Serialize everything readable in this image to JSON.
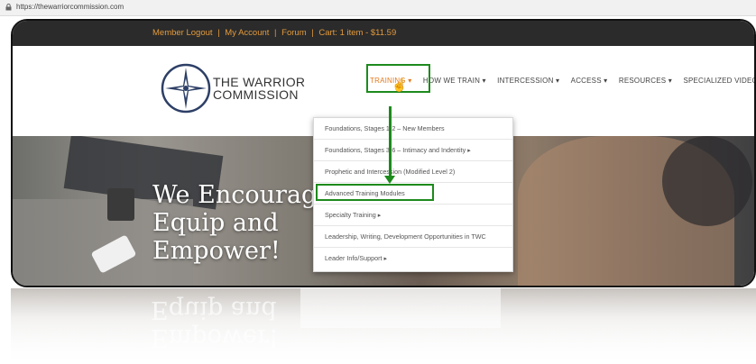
{
  "browser": {
    "url": "https://thewarriorcommission.com",
    "lock_icon": "lock-icon"
  },
  "topbar": {
    "member_logout": "Member Logout",
    "sep1": "|",
    "my_account": "My Account",
    "sep2": "|",
    "forum": "Forum",
    "sep3": "|",
    "cart": "Cart: 1 item - $11.59"
  },
  "brand": {
    "line1": "THE WARRIOR",
    "line2": "COMMISSION",
    "logo_icon": "compass-emblem-icon"
  },
  "nav": {
    "items": [
      {
        "label": "TRAINING ▾"
      },
      {
        "label": "HOW WE TRAIN ▾"
      },
      {
        "label": "INTERCESSION ▾"
      },
      {
        "label": "ACCESS ▾"
      },
      {
        "label": "RESOURCES ▾"
      },
      {
        "label": "SPECIALIZED VIDEOS"
      }
    ]
  },
  "dropdown": {
    "items": [
      {
        "label": "Foundations, Stages 1-2 – New Members"
      },
      {
        "label": "Foundations, Stages 3-6 – Intimacy and Indentity ▸"
      },
      {
        "label": "Prophetic and Intercession (Modified Level 2)"
      },
      {
        "label": "Advanced Training Modules"
      },
      {
        "label": "Specialty Training ▸"
      },
      {
        "label": "Leadership, Writing, Development Opportunities in TWC"
      },
      {
        "label": "Leader Info/Support ▸"
      }
    ]
  },
  "hero": {
    "line1": "We Encourag",
    "line2": "Equip and",
    "line3": "Empower!"
  },
  "colors": {
    "accent_orange": "#e3791f",
    "highlight_green": "#1d8a1d",
    "topbar_bg": "#2b2b2b"
  }
}
